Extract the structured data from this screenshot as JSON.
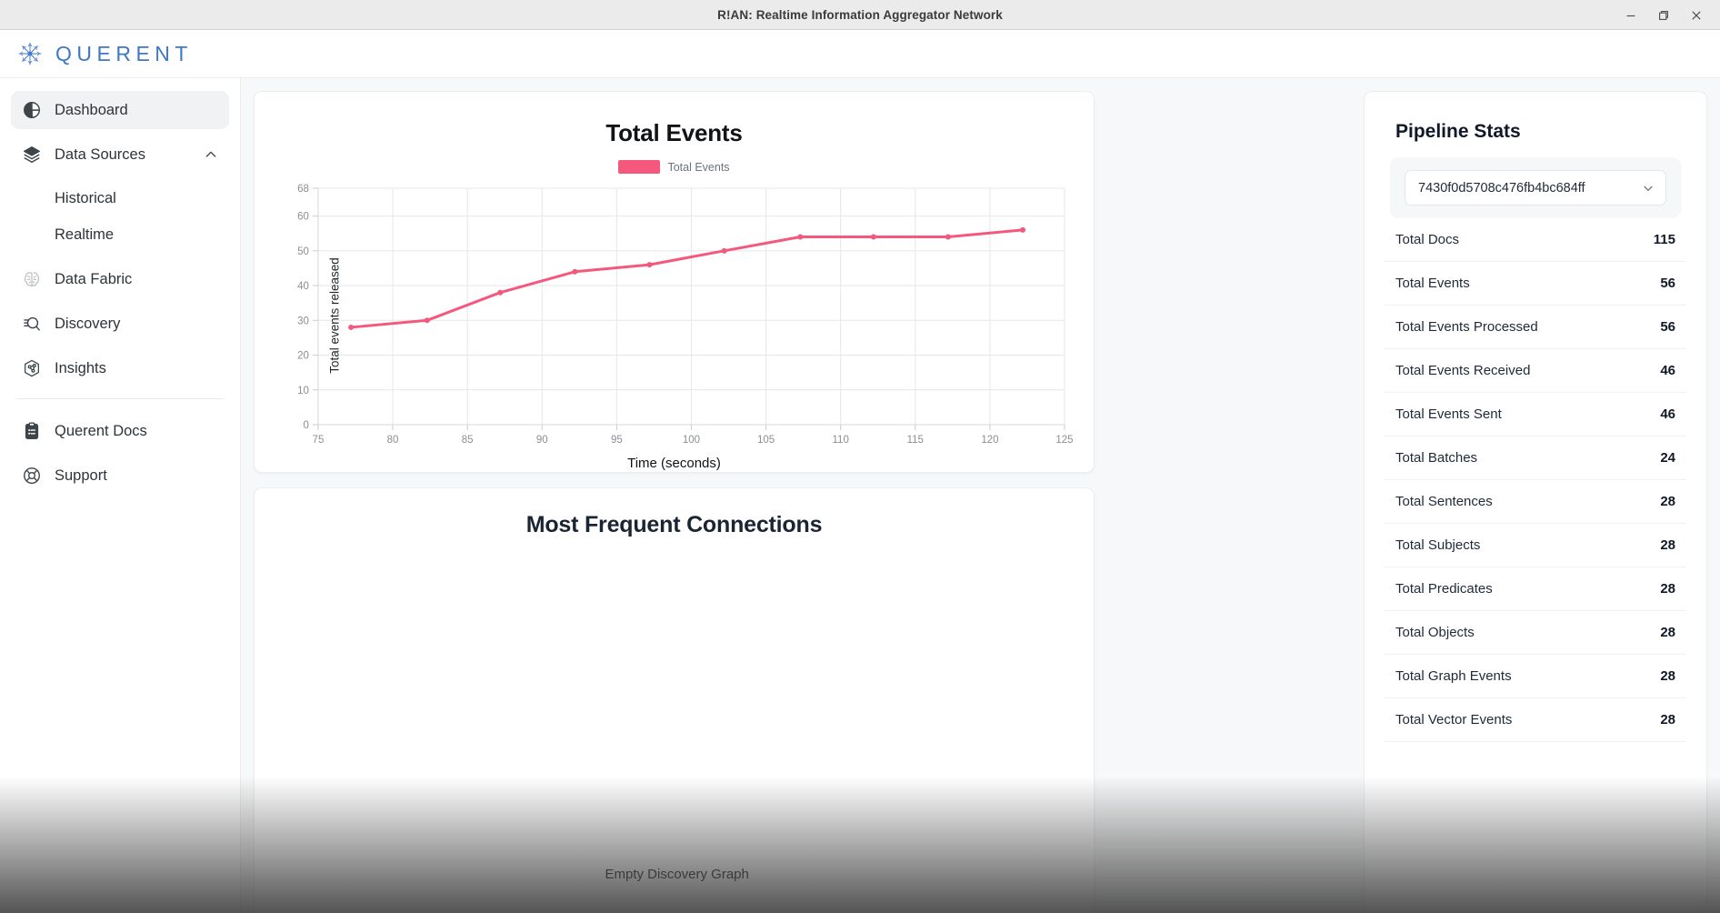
{
  "window": {
    "title": "R!AN: Realtime Information Aggregator Network",
    "minimize_label": "─",
    "maximize_label": "❐",
    "close_label": "✕"
  },
  "header": {
    "brand_name": "QUERENT"
  },
  "sidebar": {
    "items": [
      {
        "label": "Dashboard",
        "icon": "dashboard-icon",
        "active": true
      },
      {
        "label": "Data Sources",
        "icon": "layers-icon",
        "expanded": true
      },
      {
        "label": "Historical",
        "icon": "none",
        "sub": true
      },
      {
        "label": "Realtime",
        "icon": "none",
        "sub": true
      },
      {
        "label": "Data Fabric",
        "icon": "brain-icon"
      },
      {
        "label": "Discovery",
        "icon": "search-list-icon"
      },
      {
        "label": "Insights",
        "icon": "insights-hex-icon"
      }
    ],
    "footer_items": [
      {
        "label": "Querent Docs",
        "icon": "clipboard-icon"
      },
      {
        "label": "Support",
        "icon": "lifebuoy-icon"
      }
    ]
  },
  "main": {
    "connections_card": {
      "title": "Most Frequent Connections",
      "empty_label": "Empty Discovery Graph"
    }
  },
  "stats": {
    "title": "Pipeline Stats",
    "pipeline_select": {
      "value": "7430f0d5708c476fb4bc684ff",
      "chevron": "chevron-down-icon"
    },
    "rows": [
      {
        "label": "Total Docs",
        "value": "115"
      },
      {
        "label": "Total Events",
        "value": "56"
      },
      {
        "label": "Total Events Processed",
        "value": "56"
      },
      {
        "label": "Total Events Received",
        "value": "46"
      },
      {
        "label": "Total Events Sent",
        "value": "46"
      },
      {
        "label": "Total Batches",
        "value": "24"
      },
      {
        "label": "Total Sentences",
        "value": "28"
      },
      {
        "label": "Total Subjects",
        "value": "28"
      },
      {
        "label": "Total Predicates",
        "value": "28"
      },
      {
        "label": "Total Objects",
        "value": "28"
      },
      {
        "label": "Total Graph Events",
        "value": "28"
      },
      {
        "label": "Total Vector Events",
        "value": "28"
      }
    ]
  },
  "chart_data": {
    "type": "line",
    "title": "Total Events",
    "xlabel": "Time (seconds)",
    "ylabel": "Total events released",
    "legend": [
      {
        "name": "Total Events",
        "color": "#f4587c"
      }
    ],
    "legend_position": "top-center",
    "grid": true,
    "xlim": [
      75,
      125
    ],
    "ylim": [
      0,
      68
    ],
    "xticks": [
      75,
      80,
      85,
      90,
      95,
      100,
      105,
      110,
      115,
      120,
      125
    ],
    "yticks": [
      0,
      10,
      20,
      30,
      40,
      50,
      60,
      68
    ],
    "series": [
      {
        "name": "Total Events",
        "color": "#f4587c",
        "x": [
          77.2,
          82.3,
          87.2,
          92.2,
          97.2,
          102.2,
          107.3,
          112.2,
          117.2,
          122.2
        ],
        "y": [
          28,
          30,
          38,
          44,
          46,
          50,
          54,
          54,
          54,
          56
        ]
      }
    ]
  }
}
